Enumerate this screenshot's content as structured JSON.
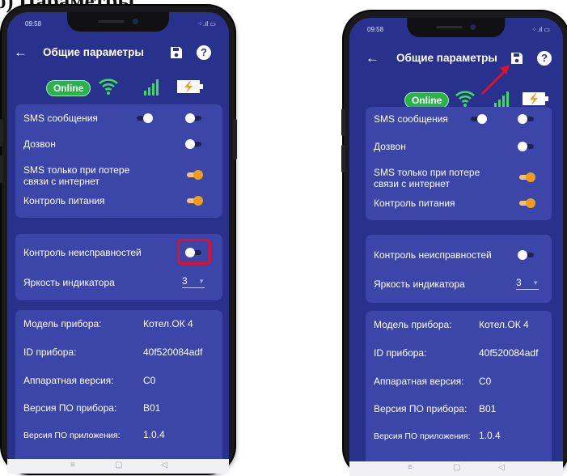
{
  "heading": "б) Параметры",
  "phones": [
    {
      "time": "09:58",
      "signal": "⁘.ıl ▭",
      "back_icon": "back-arrow-icon",
      "title": "Общие параметры",
      "online_label": "Online",
      "settings": [
        {
          "label": "SMS сообщения",
          "state": "off"
        },
        {
          "label": "Дозвон",
          "state": "off"
        },
        {
          "label": "SMS только при потере связи с интернет",
          "state": "on"
        },
        {
          "label": "Контроль питания",
          "state": "on"
        }
      ],
      "fault_label": "Контроль неисправностей",
      "fault_state": "off",
      "brightness_label": "Яркость индикатора",
      "brightness_value": "3",
      "info": [
        {
          "label": "Модель прибора:",
          "value": "Котел.ОК 4"
        },
        {
          "label": "ID прибора:",
          "value": "40f520084adf"
        },
        {
          "label": "Аппаратная версия:",
          "value": "C0"
        },
        {
          "label": "Версия ПО прибора:",
          "value": "B01"
        },
        {
          "label": "Версия ПО приложения:",
          "value": "1.0.4"
        }
      ],
      "highlight": "fault-toggle"
    },
    {
      "time": "09:58",
      "signal": "⁘.ıl ▭",
      "title": "Общие параметры",
      "online_label": "Online",
      "settings": [
        {
          "label": "SMS сообщения",
          "state": "off"
        },
        {
          "label": "Дозвон",
          "state": "off"
        },
        {
          "label": "SMS только при потере связи с интернет",
          "state": "on"
        },
        {
          "label": "Контроль питания",
          "state": "on"
        }
      ],
      "fault_label": "Контроль неисправностей",
      "fault_state": "off",
      "brightness_label": "Яркость индикатора",
      "brightness_value": "3",
      "info": [
        {
          "label": "Модель прибора:",
          "value": "Котел.ОК 4"
        },
        {
          "label": "ID прибора:",
          "value": "40f520084adf"
        },
        {
          "label": "Аппаратная версия:",
          "value": "C0"
        },
        {
          "label": "Версия ПО прибора:",
          "value": "B01"
        },
        {
          "label": "Версия ПО приложения:",
          "value": "1.0.4"
        }
      ],
      "highlight": "save-button"
    }
  ],
  "colors": {
    "screen_bg": "#28318c",
    "card_bg": "#3b46a8",
    "online_green": "#2bb24c",
    "toggle_on": "#f59b1b",
    "highlight_red": "#e2102a"
  },
  "navbar": {
    "menu_glyph": "≡",
    "home_glyph": "▢",
    "back_glyph": "◁"
  }
}
